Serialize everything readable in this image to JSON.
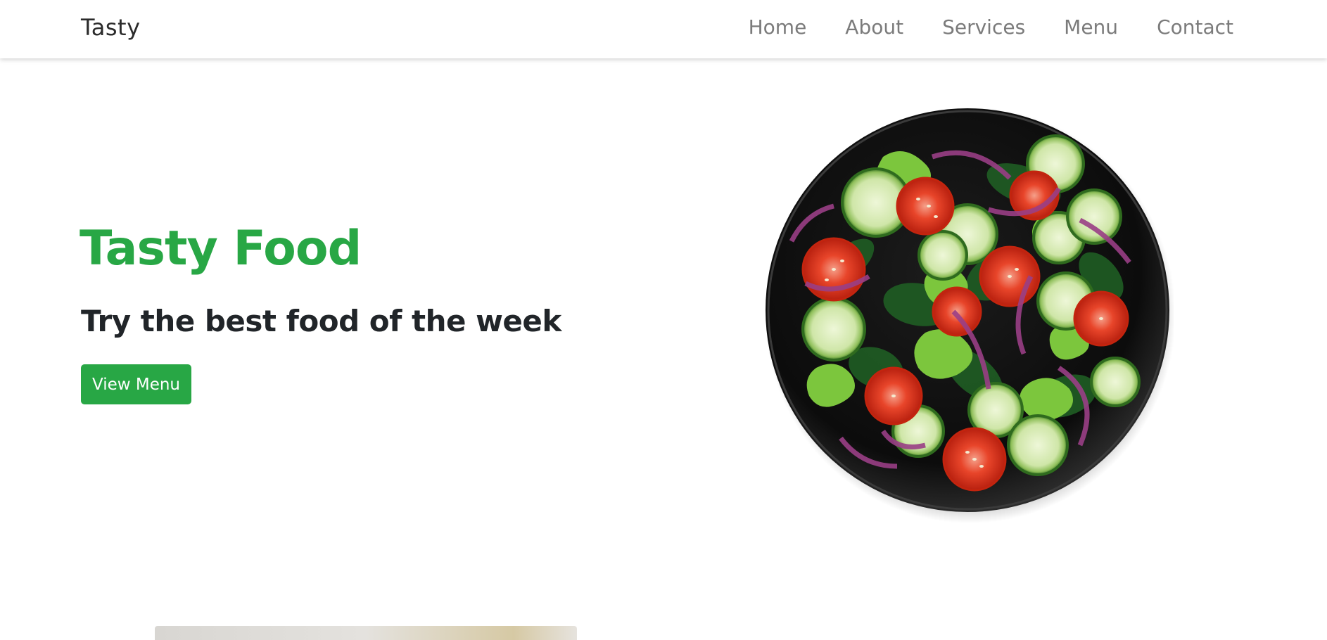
{
  "navbar": {
    "brand": "Tasty",
    "links": [
      "Home",
      "About",
      "Services",
      "Menu",
      "Contact"
    ]
  },
  "hero": {
    "title": "Tasty Food",
    "subtitle": "Try the best food of the week",
    "button_label": "View Menu"
  },
  "colors": {
    "accent": "#28a745",
    "text_dark": "#212529",
    "nav_text": "#7b7b7b"
  },
  "images": {
    "hero": "salad-bowl-image",
    "next_section": "food-image-partial"
  }
}
